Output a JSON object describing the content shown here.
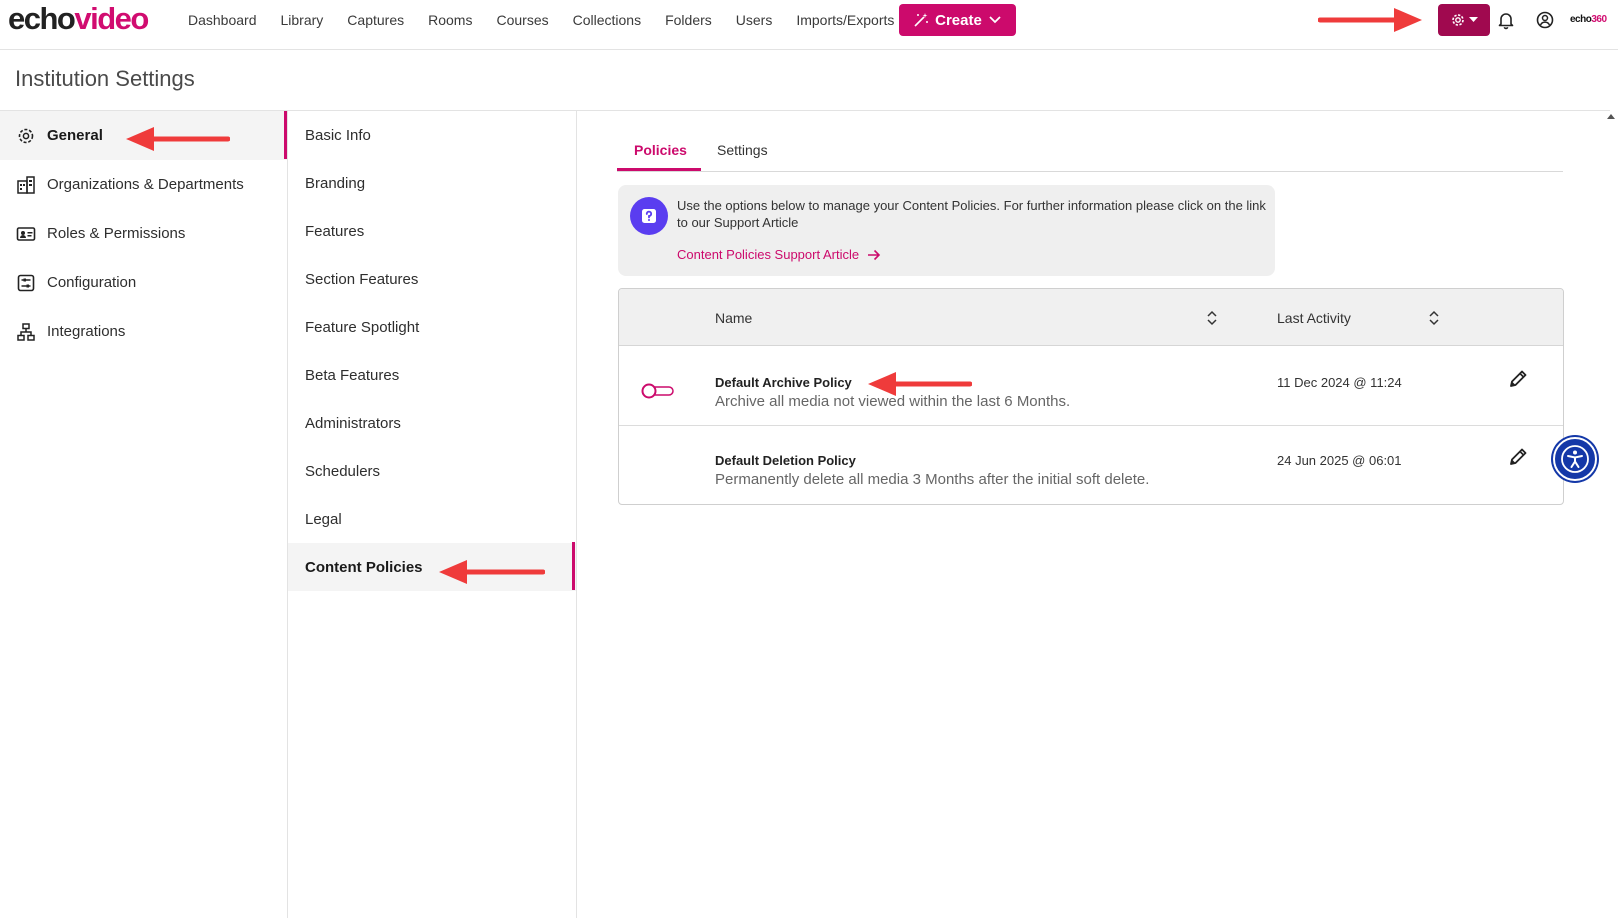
{
  "brand": {
    "part1": "echo",
    "part2": "video",
    "small_a": "echo",
    "small_b": "360"
  },
  "nav": [
    "Dashboard",
    "Library",
    "Captures",
    "Rooms",
    "Courses",
    "Collections",
    "Folders",
    "Users",
    "Imports/Exports"
  ],
  "create_label": "Create",
  "page_title": "Institution Settings",
  "sidebar": [
    {
      "label": "General",
      "icon": "gear-icon",
      "active": true
    },
    {
      "label": "Organizations & Departments",
      "icon": "building-icon"
    },
    {
      "label": "Roles & Permissions",
      "icon": "id-card-icon"
    },
    {
      "label": "Configuration",
      "icon": "sliders-icon"
    },
    {
      "label": "Integrations",
      "icon": "network-icon"
    }
  ],
  "submenu": [
    "Basic Info",
    "Branding",
    "Features",
    "Section Features",
    "Feature Spotlight",
    "Beta Features",
    "Administrators",
    "Schedulers",
    "Legal",
    "Content Policies"
  ],
  "submenu_active": "Content Policies",
  "tabs": [
    "Policies",
    "Settings"
  ],
  "info": {
    "text": "Use the options below to manage your Content Policies. For further information please click on the link to our Support Article",
    "link": "Content Policies Support Article"
  },
  "table": {
    "headers": {
      "name": "Name",
      "last_activity": "Last Activity"
    },
    "rows": [
      {
        "name": "Default Archive Policy",
        "description": "Archive all media not viewed within the last 6 Months.",
        "last_activity": "11 Dec 2024 @ 11:24",
        "has_toggle": true,
        "toggle_on": false
      },
      {
        "name": "Default Deletion Policy",
        "description": "Permanently delete all media 3 Months after the initial soft delete.",
        "last_activity": "24 Jun 2025 @ 06:01",
        "has_toggle": false
      }
    ]
  },
  "colors": {
    "accent": "#cc0a6c",
    "settings_btn": "#a0094f",
    "annotation_arrow": "#ef3b3b",
    "info_icon": "#5a3df0",
    "a11y": "#1438a8"
  }
}
